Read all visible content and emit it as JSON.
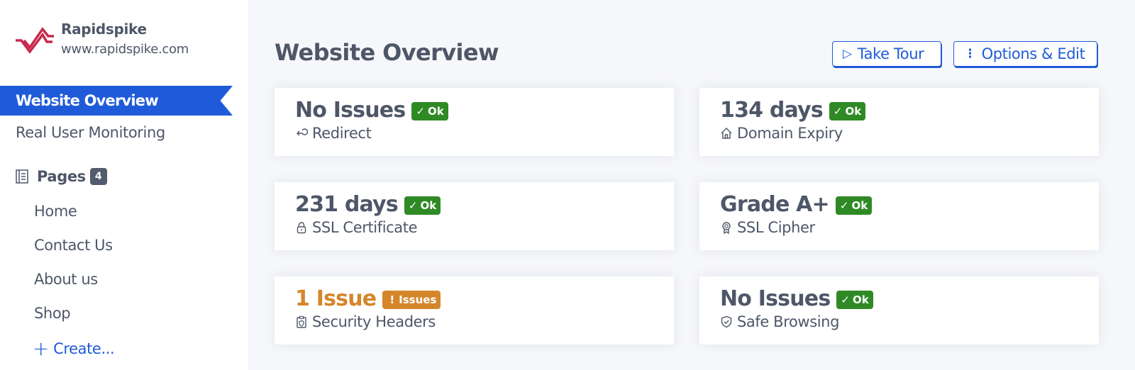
{
  "brand": {
    "name": "Rapidspike",
    "url": "www.rapidspike.com",
    "logo_icon": "pulse-logo-icon",
    "logo_color": "#c8284c"
  },
  "sidebar": {
    "active_item": "Website Overview",
    "items": [
      {
        "label": "Website Overview",
        "active": true
      },
      {
        "label": "Real User Monitoring",
        "active": false
      }
    ],
    "pages": {
      "label": "Pages",
      "icon": "page-list-icon",
      "count": "4",
      "items": [
        "Home",
        "Contact Us",
        "About us",
        "Shop"
      ],
      "create_label": "Create..."
    }
  },
  "header": {
    "title": "Website Overview",
    "buttons": {
      "tour": {
        "label": "Take Tour",
        "icon": "play-icon"
      },
      "options": {
        "label": "Options & Edit",
        "icon": "vertical-dots-icon"
      }
    }
  },
  "colors": {
    "accent": "#1f5bd8",
    "ok": "#2f8a25",
    "warning": "#d4862b",
    "text": "#4e5768",
    "background": "#f6f7fa"
  },
  "cards": [
    {
      "value": "No Issues",
      "status": "Ok",
      "status_type": "ok",
      "label": "Redirect",
      "icon": "redirect-icon"
    },
    {
      "value": "134 days",
      "status": "Ok",
      "status_type": "ok",
      "label": "Domain Expiry",
      "icon": "home-icon"
    },
    {
      "value": "231 days",
      "status": "Ok",
      "status_type": "ok",
      "label": "SSL Certificate",
      "icon": "lock-icon"
    },
    {
      "value": "Grade A+",
      "status": "Ok",
      "status_type": "ok",
      "label": "SSL Cipher",
      "icon": "award-icon"
    },
    {
      "value": "1 Issue",
      "status": "Issues",
      "status_type": "issue",
      "label": "Security Headers",
      "icon": "clipboard-shield-icon"
    },
    {
      "value": "No Issues",
      "status": "Ok",
      "status_type": "ok",
      "label": "Safe Browsing",
      "icon": "shield-check-icon"
    }
  ]
}
